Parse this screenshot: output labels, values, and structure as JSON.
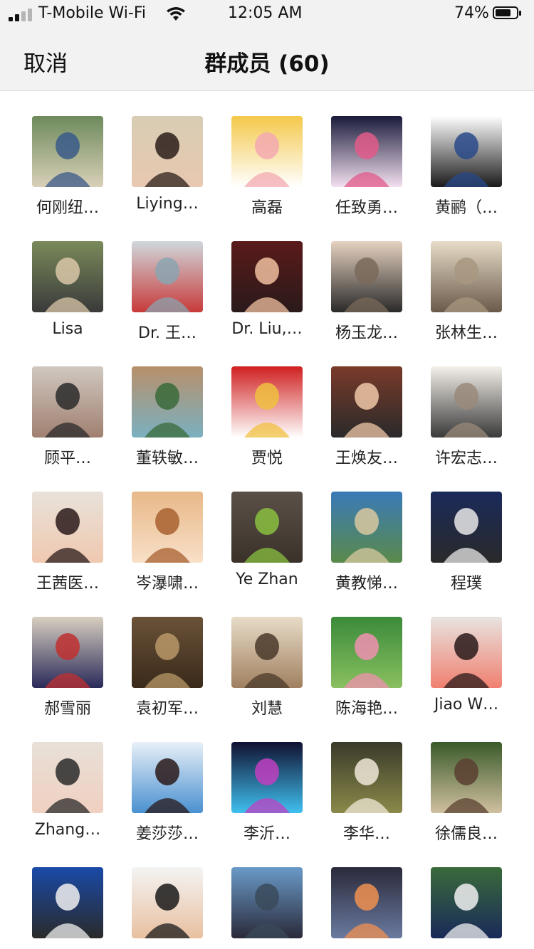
{
  "status_bar": {
    "carrier": "T-Mobile Wi-Fi",
    "time": "12:05 AM",
    "battery": "74%",
    "battery_level": 0.74
  },
  "nav": {
    "cancel_label": "取消",
    "title": "群成员 (60)"
  },
  "members": [
    {
      "name": "何刚纽…",
      "avatar": "tennis-court-photo",
      "colors": [
        "#6d8a5c",
        "#3a5a8a",
        "#d9d0b8"
      ]
    },
    {
      "name": "Liying…",
      "avatar": "woman-glasses-photo",
      "colors": [
        "#d8cdb4",
        "#2b1f1a",
        "#e8c8b0"
      ]
    },
    {
      "name": "高磊",
      "avatar": "cartoon-pig-image",
      "colors": [
        "#f4c84a",
        "#f3a9b0",
        "#ffffff"
      ]
    },
    {
      "name": "任致勇…",
      "avatar": "fireworks-photo",
      "colors": [
        "#1a1b3a",
        "#e25a8a",
        "#f3e0f0"
      ]
    },
    {
      "name": "黄鹂（…",
      "avatar": "university-seal-portrait",
      "colors": [
        "#ffffff",
        "#2a4a8a",
        "#1a1a1a"
      ]
    },
    {
      "name": "Lisa",
      "avatar": "kids-playing-photo",
      "colors": [
        "#7a8a5a",
        "#d9c7a8",
        "#3a3a3a"
      ]
    },
    {
      "name": "Dr. 王…",
      "avatar": "sailboats-photo",
      "colors": [
        "#cfd8dc",
        "#8aa4b0",
        "#c83a3a"
      ]
    },
    {
      "name": "Dr. Liu,…",
      "avatar": "woman-portrait-photo",
      "colors": [
        "#5a1a1a",
        "#f0c0a0",
        "#2a1a1a"
      ]
    },
    {
      "name": "杨玉龙…",
      "avatar": "jumping-road-photo",
      "colors": [
        "#e6d2c0",
        "#7a6a5a",
        "#2a2a2a"
      ]
    },
    {
      "name": "张林生…",
      "avatar": "sepia-headphones-photo",
      "colors": [
        "#e8dcc8",
        "#a89880",
        "#6a5a4a"
      ]
    },
    {
      "name": "顾平…",
      "avatar": "camera-photographer-photo",
      "colors": [
        "#d0c8c0",
        "#2a2a2a",
        "#a08070"
      ]
    },
    {
      "name": "董轶敏…",
      "avatar": "resort-mountain-photo",
      "colors": [
        "#b8906a",
        "#3a6a3a",
        "#7ab0c0"
      ]
    },
    {
      "name": "贾悦",
      "avatar": "monkey-new-year-image",
      "colors": [
        "#d02020",
        "#f0c040",
        "#ffffff"
      ]
    },
    {
      "name": "王焕友…",
      "avatar": "man-glasses-portrait",
      "colors": [
        "#7a3a2a",
        "#f0c8a8",
        "#2a2a2a"
      ]
    },
    {
      "name": "许宏志…",
      "avatar": "man-sketch-portrait",
      "colors": [
        "#f4f0ea",
        "#9a8a7a",
        "#3a3a3a"
      ]
    },
    {
      "name": "王茜医…",
      "avatar": "woman-smiling-portrait",
      "colors": [
        "#e8e2da",
        "#2a1a1a",
        "#f0c8b0"
      ]
    },
    {
      "name": "岑瀑啸…",
      "avatar": "leaf-carving-image",
      "colors": [
        "#e8b888",
        "#a86030",
        "#f8e0c8"
      ]
    },
    {
      "name": "Ye Zhan",
      "avatar": "sprout-photo",
      "colors": [
        "#5a5048",
        "#8ac040",
        "#3a322a"
      ]
    },
    {
      "name": "黄教悌…",
      "avatar": "coastal-cliff-photo",
      "colors": [
        "#3a7ab8",
        "#d8c8a0",
        "#5a8a4a"
      ]
    },
    {
      "name": "程璞",
      "avatar": "blue-car-photo",
      "colors": [
        "#1a2a5a",
        "#e8e8e8",
        "#2a2a2a"
      ]
    },
    {
      "name": "郝雪丽",
      "avatar": "woman-indoor-photo",
      "colors": [
        "#d8cfc0",
        "#c03030",
        "#2a2a5a"
      ]
    },
    {
      "name": "袁初军…",
      "avatar": "horn-instrument-image",
      "colors": [
        "#6a5238",
        "#b89868",
        "#3a2a1a"
      ]
    },
    {
      "name": "刘慧",
      "avatar": "vintage-collage-image",
      "colors": [
        "#e8dcc8",
        "#4a3a2a",
        "#a08060"
      ]
    },
    {
      "name": "陈海艳…",
      "avatar": "lotus-flower-photo",
      "colors": [
        "#3a8a3a",
        "#f090b0",
        "#8ac060"
      ]
    },
    {
      "name": "Jiao W…",
      "avatar": "woman-peace-sign-photo",
      "colors": [
        "#e8e4e0",
        "#2a1a1a",
        "#f08070"
      ]
    },
    {
      "name": "Zhang…",
      "avatar": "woman-baby-photo",
      "colors": [
        "#e8e0d8",
        "#2a2a2a",
        "#f0d0c0"
      ]
    },
    {
      "name": "姜莎莎…",
      "avatar": "cartoon-doctor-image",
      "colors": [
        "#e8f0f8",
        "#2a1a1a",
        "#4a90d0"
      ]
    },
    {
      "name": "李沂…",
      "avatar": "canton-tower-lights-photo",
      "colors": [
        "#101030",
        "#c040c0",
        "#40c0f0"
      ]
    },
    {
      "name": "李华…",
      "avatar": "puppies-photo",
      "colors": [
        "#3a3a2a",
        "#f0e8d8",
        "#8a8a4a"
      ]
    },
    {
      "name": "徐儒良…",
      "avatar": "eagle-photo",
      "colors": [
        "#3a5a2a",
        "#5a4030",
        "#d0c0a0"
      ]
    },
    {
      "name": "",
      "avatar": "presenter-map-photo",
      "colors": [
        "#1a4aa8",
        "#f0f0f0",
        "#2a2a2a"
      ]
    },
    {
      "name": "",
      "avatar": "man-glasses-white-coat-photo",
      "colors": [
        "#f4f4f4",
        "#1a1a1a",
        "#e8c0a0"
      ]
    },
    {
      "name": "",
      "avatar": "man-waterfront-photo",
      "colors": [
        "#6a9ac8",
        "#3a4a5a",
        "#2a2a3a"
      ]
    },
    {
      "name": "",
      "avatar": "sunset-lake-photo",
      "colors": [
        "#2a2a3a",
        "#f09050",
        "#6a7aa0"
      ]
    },
    {
      "name": "",
      "avatar": "man-white-hair-portrait",
      "colors": [
        "#3a6a3a",
        "#f0f0f0",
        "#1a2a5a"
      ]
    }
  ]
}
